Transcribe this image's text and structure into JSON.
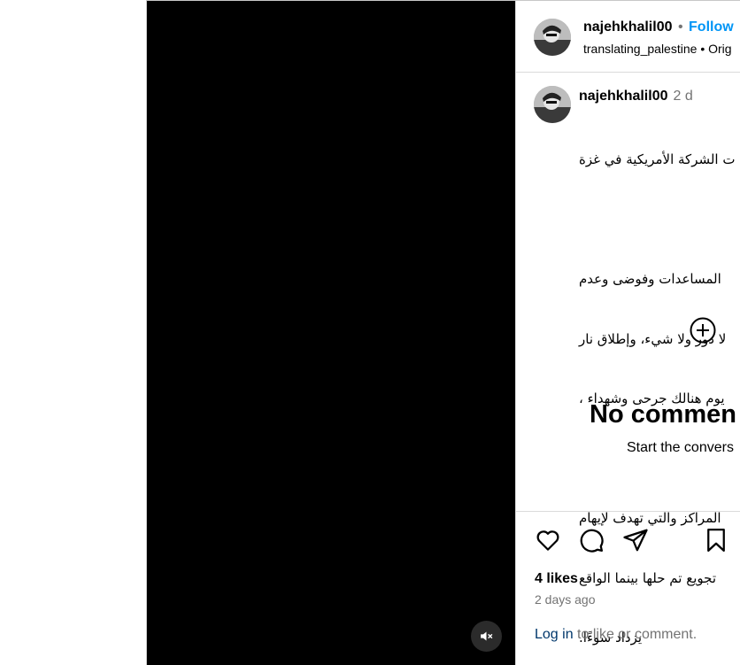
{
  "post": {
    "username": "najehkhalil00",
    "follow_label": "Follow",
    "separator": "•",
    "sub_user": "translating_palestine",
    "sub_info": "• Orig"
  },
  "caption": {
    "username": "najehkhalil00",
    "time": "2 d",
    "lines": [
      "ت الشركة الأمريكية في غزة",
      "",
      "المساعدات وفوضى وعدم",
      "لا دور ولا شيء، وإطلاق نار",
      "، يوم هنالك جرحى وشهداء",
      "",
      "المراكز والتي تهدف لإيهام",
      "تجويع تم حلها بينما الواقع",
      ".يزداد سوءًا"
    ]
  },
  "comments": {
    "empty_title": "No commen",
    "empty_subtitle": "Start the convers"
  },
  "actions": {
    "likes": "4 likes",
    "time_ago": "2 days ago",
    "login_label": "Log in",
    "login_suffix": " to like or comment."
  },
  "icons": {
    "mute": "speaker-muted-icon",
    "add_comment": "plus-circle-icon",
    "like": "heart-icon",
    "comment": "comment-bubble-icon",
    "share": "paper-plane-icon",
    "save": "bookmark-icon"
  },
  "colors": {
    "accent": "#0095f6",
    "muted_text": "#737373",
    "link": "#00376b"
  }
}
